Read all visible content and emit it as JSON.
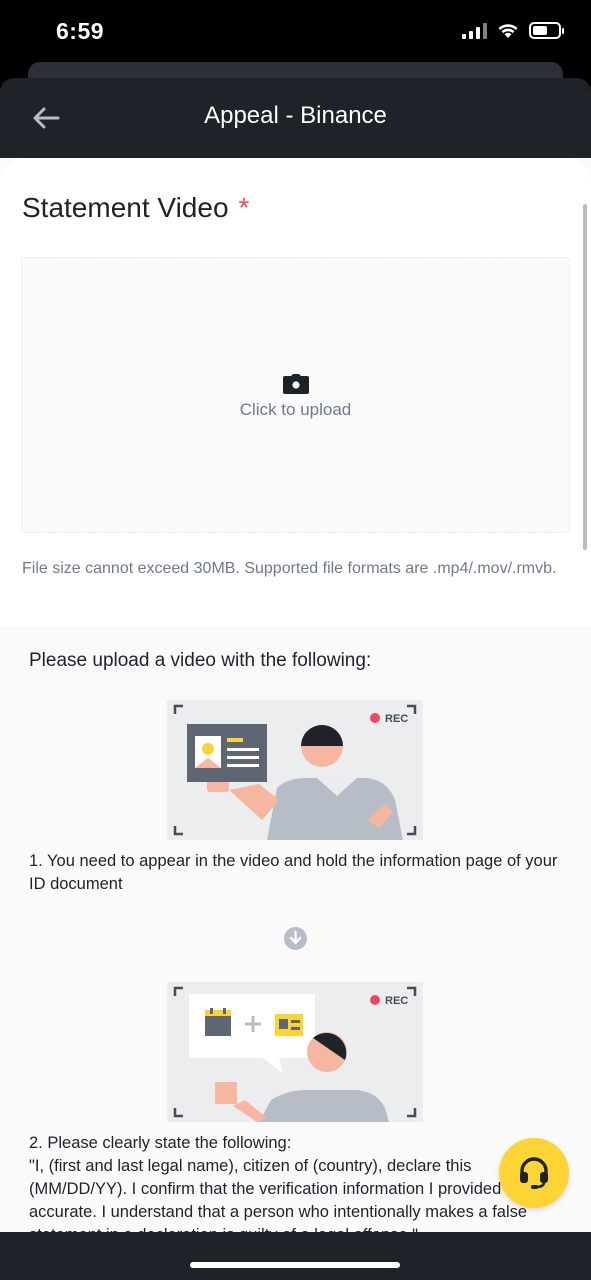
{
  "status_bar": {
    "time": "6:59"
  },
  "header": {
    "title": "Appeal - Binance"
  },
  "upload": {
    "title": "Statement Video",
    "required_mark": "*",
    "upload_label": "Click to upload",
    "hint": "File size cannot exceed 30MB. Supported file formats are .mp4/.mov/.rmvb."
  },
  "instructions": {
    "title": "Please upload a video with the following:",
    "rec_label": "REC",
    "step1": "1. You need to appear in the video and hold the information page of your ID document",
    "step2_heading": "2. Please clearly state the following:",
    "step2_quote": "\"I, (first and last legal name), citizen of (country), declare this (MM/DD/YY). I confirm that the verification information I provided is accurate. I understand that a person who intentionally makes a false statement in a declaration is guilty of a legal offense.\""
  },
  "icons": {
    "back": "arrow-left-icon",
    "camera": "camera-icon",
    "down": "arrow-down-circle-icon",
    "help": "headset-icon"
  },
  "colors": {
    "accent": "#fcd535",
    "required": "#f6465d",
    "header_bg": "#1e2329",
    "rec_dot": "#f6465d"
  }
}
